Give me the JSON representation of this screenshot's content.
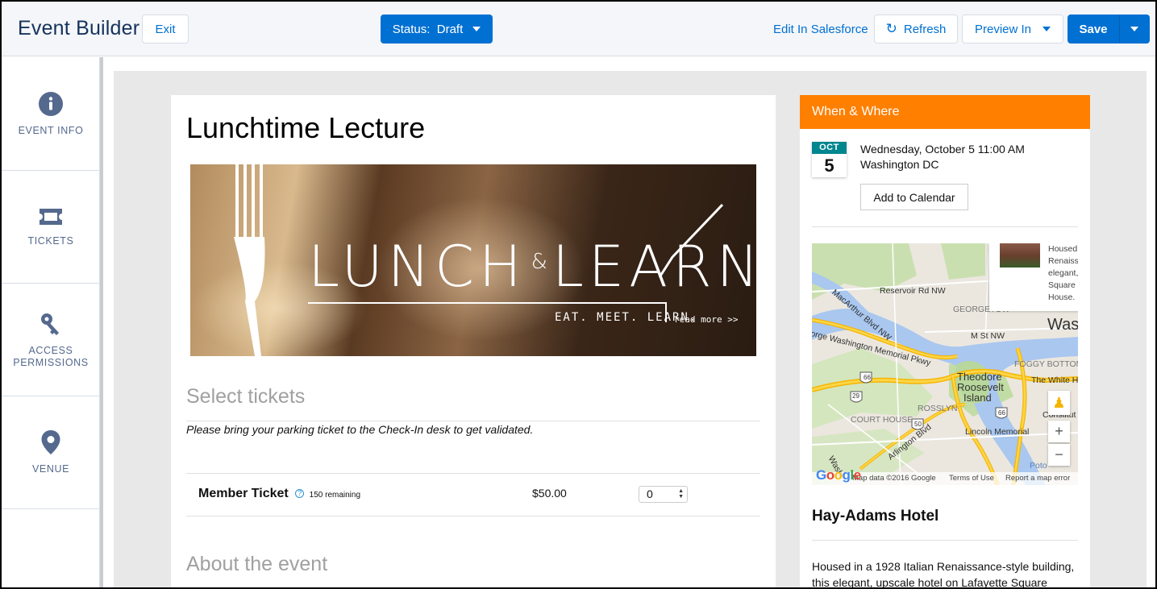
{
  "header": {
    "title": "Event Builder",
    "exit_label": "Exit",
    "status_label": "Status:  Draft",
    "edit_link": "Edit In Salesforce",
    "refresh_label": "Refresh",
    "preview_label": "Preview In",
    "save_label": "Save"
  },
  "sidebar": {
    "items": [
      {
        "label": "EVENT INFO",
        "icon": "info-icon"
      },
      {
        "label": "TICKETS",
        "icon": "ticket-icon"
      },
      {
        "label_line1": "ACCESS",
        "label_line2": "PERMISSIONS",
        "icon": "key-icon"
      },
      {
        "label": "VENUE",
        "icon": "location-pin-icon"
      }
    ]
  },
  "event": {
    "title": "Lunchtime Lecture",
    "banner_title_left": "LUNCH",
    "banner_title_amp": "&",
    "banner_title_right": "LEARN",
    "banner_tagline": "EAT. MEET. LEARN.",
    "banner_read_more": "read more >>",
    "select_tickets_title": "Select tickets",
    "ticket_note": "Please bring your parking ticket to the Check-In desk to get validated.",
    "tickets": [
      {
        "name": "Member Ticket",
        "help": "?",
        "remaining": "150 remaining",
        "price": "$50.00",
        "quantity": "0"
      }
    ],
    "about_title": "About the event"
  },
  "when_where": {
    "header": "When & Where",
    "month": "OCT",
    "day": "5",
    "date_text": "Wednesday, October 5 11:00 AM",
    "place_text": "Washington DC",
    "add_to_calendar": "Add to Calendar"
  },
  "map": {
    "infobox_lines": [
      "Housed",
      "Renaiss",
      "elegant,",
      "Square",
      "House."
    ],
    "labels": {
      "reservoir": "Reservoir Rd NW",
      "macarthur": "MacArthur Blvd NW",
      "georgetown": "GEORGETOW",
      "was": "Was",
      "mst": "M St NW",
      "gwp": "orge Washington Memorial Pkwy",
      "foggy": "FOGGY BOTTOM",
      "theodore": "Theodore",
      "roosevelt": "Roosevelt",
      "island": "Island",
      "whitehouse": "The White H",
      "rosslyn": "ROSSLYN",
      "courthouse": "COURT HOUSE",
      "arlington": "Arlington Blvd",
      "constitution": "Constitut",
      "lincoln": "Lincoln Memorial",
      "route66": "66",
      "route29": "29",
      "route50": "50",
      "poto": "Poto",
      "wash": "Washi"
    },
    "zoom_in": "+",
    "zoom_out": "−",
    "footer_data": "Map data ©2016 Google",
    "footer_terms": "Terms of Use",
    "footer_report": "Report a map error",
    "google": "Google"
  },
  "venue": {
    "name": "Hay-Adams Hotel",
    "description": "Housed in a 1928 Italian Renaissance-style building, this elegant, upscale hotel on Lafayette Square"
  },
  "colors": {
    "brand_blue": "#0070d2",
    "when_where_header": "#ff7f00",
    "calendar_month": "#00868f"
  }
}
